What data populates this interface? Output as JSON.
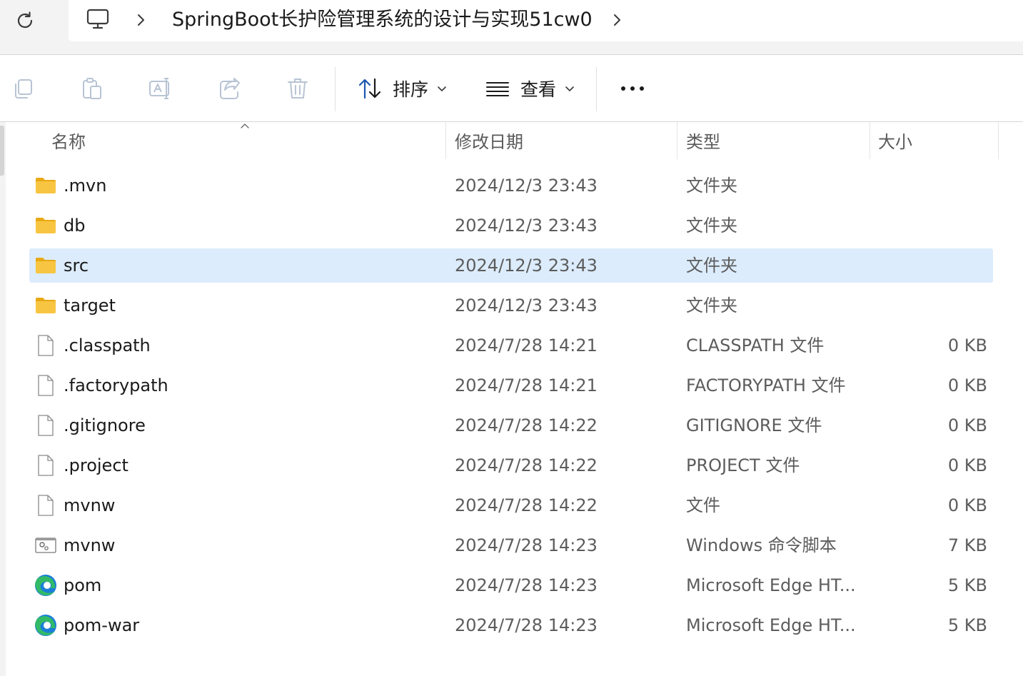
{
  "breadcrumb": {
    "path": "SpringBoot长护险管理系统的设计与实现51cw0"
  },
  "toolbar": {
    "sort_label": "排序",
    "view_label": "查看"
  },
  "columns": {
    "name": "名称",
    "date": "修改日期",
    "type": "类型",
    "size": "大小"
  },
  "files": [
    {
      "name": ".mvn",
      "date": "2024/12/3 23:43",
      "type": "文件夹",
      "size": "",
      "icon": "folder-icon"
    },
    {
      "name": "db",
      "date": "2024/12/3 23:43",
      "type": "文件夹",
      "size": "",
      "icon": "folder-icon"
    },
    {
      "name": "src",
      "date": "2024/12/3 23:43",
      "type": "文件夹",
      "size": "",
      "icon": "folder-icon",
      "selected": true
    },
    {
      "name": "target",
      "date": "2024/12/3 23:43",
      "type": "文件夹",
      "size": "",
      "icon": "folder-icon"
    },
    {
      "name": ".classpath",
      "date": "2024/7/28 14:21",
      "type": "CLASSPATH 文件",
      "size": "0 KB",
      "icon": "file-icon"
    },
    {
      "name": ".factorypath",
      "date": "2024/7/28 14:21",
      "type": "FACTORYPATH 文件",
      "size": "0 KB",
      "icon": "file-icon"
    },
    {
      "name": ".gitignore",
      "date": "2024/7/28 14:22",
      "type": "GITIGNORE 文件",
      "size": "0 KB",
      "icon": "file-icon"
    },
    {
      "name": ".project",
      "date": "2024/7/28 14:22",
      "type": "PROJECT 文件",
      "size": "0 KB",
      "icon": "file-icon"
    },
    {
      "name": "mvnw",
      "date": "2024/7/28 14:22",
      "type": "文件",
      "size": "0 KB",
      "icon": "file-icon"
    },
    {
      "name": "mvnw",
      "date": "2024/7/28 14:23",
      "type": "Windows 命令脚本",
      "size": "7 KB",
      "icon": "script-icon"
    },
    {
      "name": "pom",
      "date": "2024/7/28 14:23",
      "type": "Microsoft Edge HT...",
      "size": "5 KB",
      "icon": "edge-icon"
    },
    {
      "name": "pom-war",
      "date": "2024/7/28 14:23",
      "type": "Microsoft Edge HT...",
      "size": "5 KB",
      "icon": "edge-icon"
    }
  ],
  "colors": {
    "selected_row": "#dcecfc",
    "folder": "#f8c542",
    "edge_blue": "#1a7fd6",
    "edge_green": "#35c15b"
  }
}
